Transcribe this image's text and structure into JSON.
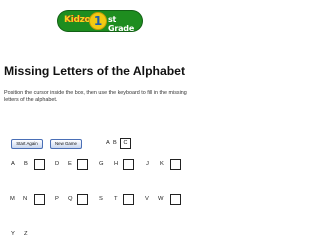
{
  "logo": {
    "kidz": "Kidzone",
    "number": "1",
    "grade": "st Grade"
  },
  "title": "Missing Letters of the Alphabet",
  "instructions": "Position the cursor inside the box, then use the keyboard to fill in the missing letters of the alphabet.",
  "buttons": {
    "start_again": "Start Again",
    "new_game": "New Game"
  },
  "sample": {
    "letters": [
      "A",
      "B"
    ],
    "answer": "C"
  },
  "rows": {
    "row1": [
      "A",
      "B",
      "D",
      "E",
      "G",
      "H",
      "J",
      "K"
    ],
    "row2": [
      "M",
      "N",
      "P",
      "Q",
      "S",
      "T",
      "V",
      "W"
    ],
    "row3": [
      "Y",
      "Z"
    ]
  }
}
